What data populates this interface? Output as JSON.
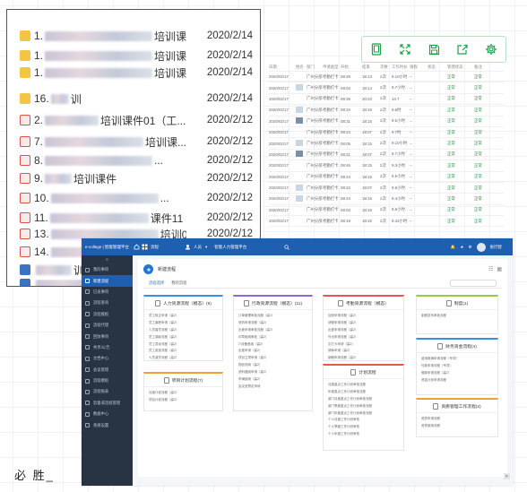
{
  "toolbar": {
    "icons": [
      "tablet-icon",
      "expand-icon",
      "save-icon",
      "share-icon",
      "settings-icon"
    ],
    "color": "#1aa344"
  },
  "bg_table": {
    "headers": [
      "日期",
      "姓名",
      "部门",
      "申请类型",
      "开始",
      "结束",
      "次数",
      "工作时长",
      "请假",
      "状态",
      "管理状态",
      "备注"
    ],
    "rows": [
      {
        "date": "2020/02/17",
        "dept": "广州分部",
        "type": "考勤打卡",
        "start": "08:29",
        "end": "18:13",
        "n": "2次",
        "dur": "9.10小时",
        "s1": "--",
        "status": "正常",
        "st2": "正常",
        "img": "none"
      },
      {
        "date": "2020/02/17",
        "dept": "广州分部",
        "type": "考勤打卡",
        "start": "08:04",
        "end": "18:14",
        "n": "2次",
        "dur": "9.7小时",
        "s1": "--",
        "status": "正常",
        "st2": "正常",
        "img": "light"
      },
      {
        "date": "2020/02/17",
        "dept": "广州分部",
        "type": "考勤打卡",
        "start": "08:39",
        "end": "20:23",
        "n": "2次",
        "dur": "10.7",
        "s1": "--",
        "status": "正常",
        "st2": "正常",
        "img": "none"
      },
      {
        "date": "2020/02/17",
        "dept": "广州分部",
        "type": "考勤打卡",
        "start": "08:34",
        "end": "18:16",
        "n": "2次",
        "dur": "9.6时",
        "s1": "--",
        "status": "正常",
        "st2": "正常",
        "img": "light"
      },
      {
        "date": "2020/02/17",
        "dept": "广州分部",
        "type": "考勤打卡",
        "start": "08:31",
        "end": "18:15",
        "n": "2次",
        "dur": "9.5小时",
        "s1": "--",
        "status": "正常",
        "st2": "正常",
        "img": "dark"
      },
      {
        "date": "2020/02/17",
        "dept": "广州分部",
        "type": "考勤打卡",
        "start": "08:24",
        "end": "18:07",
        "n": "2次",
        "dur": "9.7时",
        "s1": "--",
        "status": "正常",
        "st2": "正常",
        "img": "none"
      },
      {
        "date": "2020/02/17",
        "dept": "广州分部",
        "type": "考勤打卡",
        "start": "08:05",
        "end": "18:15",
        "n": "2次",
        "dur": "9.10小时",
        "s1": "--",
        "status": "正常",
        "st2": "正常",
        "img": "light"
      },
      {
        "date": "2020/02/17",
        "dept": "广州分部",
        "type": "考勤打卡",
        "start": "08:21",
        "end": "18:07",
        "n": "2次",
        "dur": "9.7小时",
        "s1": "--",
        "status": "正常",
        "st2": "正常",
        "img": "dark"
      },
      {
        "date": "2020/02/17",
        "dept": "广州分部",
        "type": "考勤打卡",
        "start": "08:46",
        "end": "18:15",
        "n": "2次",
        "dur": "9.3小时",
        "s1": "--",
        "status": "正常",
        "st2": "正常",
        "img": "none"
      },
      {
        "date": "2020/02/17",
        "dept": "广州分部",
        "type": "考勤打卡",
        "start": "08:24",
        "end": "18:16",
        "n": "2次",
        "dur": "9.5小时",
        "s1": "--",
        "status": "正常",
        "st2": "正常",
        "img": "none"
      },
      {
        "date": "2020/02/17",
        "dept": "广州分部",
        "type": "考勤打卡",
        "start": "08:22",
        "end": "18:07",
        "n": "2次",
        "dur": "9.6小时",
        "s1": "--",
        "status": "正常",
        "st2": "正常",
        "img": "light"
      },
      {
        "date": "2020/02/17",
        "dept": "广州分部",
        "type": "考勤打卡",
        "start": "08:24",
        "end": "18:15",
        "n": "2次",
        "dur": "9.4小时",
        "s1": "--",
        "status": "正常",
        "st2": "正常",
        "img": "light"
      },
      {
        "date": "2020/02/17",
        "dept": "广州分部",
        "type": "考勤打卡",
        "start": "08:03",
        "end": "18:16",
        "n": "2次",
        "dur": "9.6小时",
        "s1": "--",
        "status": "正常",
        "st2": "正常",
        "img": "none"
      },
      {
        "date": "2020/02/17",
        "dept": "广州分部",
        "type": "考勤打卡",
        "start": "08:19",
        "end": "18:15",
        "n": "2次",
        "dur": "9.42小时",
        "s1": "--",
        "status": "正常",
        "st2": "正常",
        "img": "none"
      }
    ]
  },
  "files": [
    {
      "num": "1.",
      "pre": 130,
      "text": "培训课...",
      "post": 0,
      "date": "2020/2/14",
      "icon": "folder"
    },
    {
      "num": "1.",
      "pre": 130,
      "text": "培训课...",
      "post": 0,
      "date": "2020/2/14",
      "icon": "folder"
    },
    {
      "num": "1.",
      "pre": 130,
      "text": "培训课...",
      "post": 0,
      "date": "2020/2/14",
      "icon": "folder"
    },
    {
      "num": "16.",
      "pre": 20,
      "text": "训",
      "post": 0,
      "date": "2020/2/14",
      "icon": "folder"
    },
    {
      "num": "2.",
      "pre": 60,
      "text": "培训课件01（工...",
      "post": 0,
      "date": "2020/2/12",
      "icon": "pdf"
    },
    {
      "num": "7.",
      "pre": 110,
      "text": "培训课...",
      "post": 0,
      "date": "2020/2/12",
      "icon": "pdf"
    },
    {
      "num": "8.",
      "pre": 120,
      "text": "...",
      "post": 0,
      "date": "2020/2/12",
      "icon": "pdf"
    },
    {
      "num": "9.",
      "pre": 30,
      "text": "培训课件",
      "post": 0,
      "date": "2020/2/12",
      "icon": "pdf"
    },
    {
      "num": "10.",
      "pre": 120,
      "text": "...",
      "post": 0,
      "date": "2020/2/12",
      "icon": "pdf"
    },
    {
      "num": "11.",
      "pre": 110,
      "text": "课件11",
      "post": 0,
      "date": "2020/2/12",
      "icon": "pdf"
    },
    {
      "num": "13.",
      "pre": 125,
      "text": "培训0...",
      "post": 0,
      "date": "2020/2/12",
      "icon": "pdf"
    },
    {
      "num": "14.",
      "pre": 105,
      "text": "...",
      "post": 0,
      "date": "2020/2/12",
      "icon": "pdf"
    },
    {
      "num": "",
      "pre": 40,
      "text": "训",
      "post": 0,
      "date": "",
      "icon": "word"
    },
    {
      "num": "",
      "pre": 90,
      "text": "",
      "post": 0,
      "date": "",
      "icon": "word"
    }
  ],
  "handwriting": "必 胜_",
  "app": {
    "logo": "e-college | 智能管理平台",
    "top_nav": [
      "流程",
      "人员",
      "智能人力管理平台"
    ],
    "user": "张行智",
    "sidebar": [
      "我的事项",
      "新建流程",
      "已发事项",
      "流程查询",
      "流程模板",
      "流程代理",
      "回收事项",
      "共享/公告",
      "文档中心",
      "会议管理",
      "流程模板",
      "流程报表",
      "监督或流程管理",
      "数据中心",
      "系统设置"
    ],
    "active_index": 1,
    "page_title": "新建流程",
    "tabs": [
      "流程选择",
      "我的流程"
    ],
    "boxes": [
      {
        "title": "人力资源流程（模态）(9)",
        "accent": "#3c8dde",
        "items": [
          "员工转正申请（高2）",
          "员工离职申请（高2）",
          "人员增员流程（高2）",
          "员工调岗流程（高2）",
          "员工异动流程（高2）",
          "员工奖惩流程（高2）",
          "人员减员流程（高2）"
        ]
      },
      {
        "title": "行政资源流程（模态）(11)",
        "accent": "#8e6bc7",
        "items": [
          "订单管理审批流程（高1）",
          "采购申请流程（高2）",
          "出差申请审批流程（高2）",
          "印章使用审批（高2）",
          "IT设备借用（高2）",
          "出差申请（高2）",
          "项目立项申请（高2）",
          "物品领用（高2）",
          "资料借阅申请（高2）",
          "车辆使用（高2）",
          "会议室预定申请"
        ]
      },
      {
        "title": "考勤资源流程（模态）",
        "accent": "#e05a4f",
        "items": [
          "加班申请流程（高2）",
          "请假申请流程（高2）",
          "出差申请流程（高2）",
          "外出申请流程（高2）",
          "忘打卡申请（高2）",
          "调休申请（高2）",
          "销假申请流程（高2）"
        ]
      },
      {
        "title": "制度(1)",
        "accent": "#9ac94a",
        "items": [
          "制度发布审批流程"
        ]
      },
      {
        "title": "财务资金流程(4)",
        "accent": "#3c8dde",
        "items": [
          "费用报销申请流程（专项）",
          "付款申请流程（专项）",
          "借款申请流程（高2）",
          "资金计划申请流程"
        ]
      },
      {
        "title": "项目计划流程(7)",
        "accent": "#f0a030",
        "items": [
          "月度计划流程（高2）",
          "项目计划流程（高2）"
        ]
      },
      {
        "title": "计划流程",
        "accent": "#e05a4f",
        "items": [
          "月度重点工作计划审批流程",
          "年度重点工作计划审批流程",
          "部门月度重点工作计划审批流程",
          "部门季度重点工作计划审批流程",
          "部门年度重点工作计划审批流程",
          "个人月度工作计划审批",
          "个人季度工作计划审批",
          "个人年度工作计划审批"
        ]
      },
      {
        "title": "资质管理工作流程(2)",
        "accent": "#f0a030",
        "items": [
          "资质申请流程",
          "资质使用流程"
        ]
      }
    ]
  }
}
